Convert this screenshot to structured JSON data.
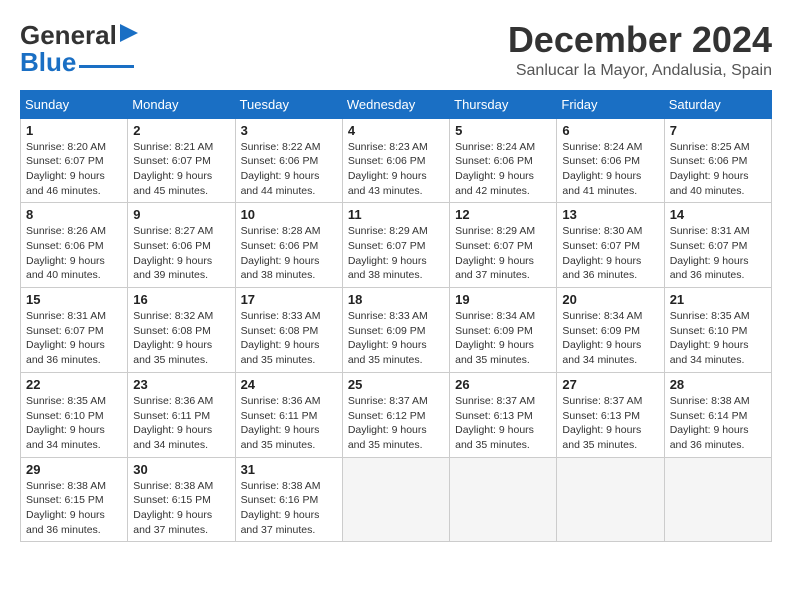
{
  "header": {
    "logo_line1": "General",
    "logo_line2": "Blue",
    "month_title": "December 2024",
    "location": "Sanlucar la Mayor, Andalusia, Spain"
  },
  "calendar": {
    "weekdays": [
      "Sunday",
      "Monday",
      "Tuesday",
      "Wednesday",
      "Thursday",
      "Friday",
      "Saturday"
    ],
    "weeks": [
      [
        {
          "day": "1",
          "sunrise": "Sunrise: 8:20 AM",
          "sunset": "Sunset: 6:07 PM",
          "daylight": "Daylight: 9 hours and 46 minutes."
        },
        {
          "day": "2",
          "sunrise": "Sunrise: 8:21 AM",
          "sunset": "Sunset: 6:07 PM",
          "daylight": "Daylight: 9 hours and 45 minutes."
        },
        {
          "day": "3",
          "sunrise": "Sunrise: 8:22 AM",
          "sunset": "Sunset: 6:06 PM",
          "daylight": "Daylight: 9 hours and 44 minutes."
        },
        {
          "day": "4",
          "sunrise": "Sunrise: 8:23 AM",
          "sunset": "Sunset: 6:06 PM",
          "daylight": "Daylight: 9 hours and 43 minutes."
        },
        {
          "day": "5",
          "sunrise": "Sunrise: 8:24 AM",
          "sunset": "Sunset: 6:06 PM",
          "daylight": "Daylight: 9 hours and 42 minutes."
        },
        {
          "day": "6",
          "sunrise": "Sunrise: 8:24 AM",
          "sunset": "Sunset: 6:06 PM",
          "daylight": "Daylight: 9 hours and 41 minutes."
        },
        {
          "day": "7",
          "sunrise": "Sunrise: 8:25 AM",
          "sunset": "Sunset: 6:06 PM",
          "daylight": "Daylight: 9 hours and 40 minutes."
        }
      ],
      [
        {
          "day": "8",
          "sunrise": "Sunrise: 8:26 AM",
          "sunset": "Sunset: 6:06 PM",
          "daylight": "Daylight: 9 hours and 40 minutes."
        },
        {
          "day": "9",
          "sunrise": "Sunrise: 8:27 AM",
          "sunset": "Sunset: 6:06 PM",
          "daylight": "Daylight: 9 hours and 39 minutes."
        },
        {
          "day": "10",
          "sunrise": "Sunrise: 8:28 AM",
          "sunset": "Sunset: 6:06 PM",
          "daylight": "Daylight: 9 hours and 38 minutes."
        },
        {
          "day": "11",
          "sunrise": "Sunrise: 8:29 AM",
          "sunset": "Sunset: 6:07 PM",
          "daylight": "Daylight: 9 hours and 38 minutes."
        },
        {
          "day": "12",
          "sunrise": "Sunrise: 8:29 AM",
          "sunset": "Sunset: 6:07 PM",
          "daylight": "Daylight: 9 hours and 37 minutes."
        },
        {
          "day": "13",
          "sunrise": "Sunrise: 8:30 AM",
          "sunset": "Sunset: 6:07 PM",
          "daylight": "Daylight: 9 hours and 36 minutes."
        },
        {
          "day": "14",
          "sunrise": "Sunrise: 8:31 AM",
          "sunset": "Sunset: 6:07 PM",
          "daylight": "Daylight: 9 hours and 36 minutes."
        }
      ],
      [
        {
          "day": "15",
          "sunrise": "Sunrise: 8:31 AM",
          "sunset": "Sunset: 6:07 PM",
          "daylight": "Daylight: 9 hours and 36 minutes."
        },
        {
          "day": "16",
          "sunrise": "Sunrise: 8:32 AM",
          "sunset": "Sunset: 6:08 PM",
          "daylight": "Daylight: 9 hours and 35 minutes."
        },
        {
          "day": "17",
          "sunrise": "Sunrise: 8:33 AM",
          "sunset": "Sunset: 6:08 PM",
          "daylight": "Daylight: 9 hours and 35 minutes."
        },
        {
          "day": "18",
          "sunrise": "Sunrise: 8:33 AM",
          "sunset": "Sunset: 6:09 PM",
          "daylight": "Daylight: 9 hours and 35 minutes."
        },
        {
          "day": "19",
          "sunrise": "Sunrise: 8:34 AM",
          "sunset": "Sunset: 6:09 PM",
          "daylight": "Daylight: 9 hours and 35 minutes."
        },
        {
          "day": "20",
          "sunrise": "Sunrise: 8:34 AM",
          "sunset": "Sunset: 6:09 PM",
          "daylight": "Daylight: 9 hours and 34 minutes."
        },
        {
          "day": "21",
          "sunrise": "Sunrise: 8:35 AM",
          "sunset": "Sunset: 6:10 PM",
          "daylight": "Daylight: 9 hours and 34 minutes."
        }
      ],
      [
        {
          "day": "22",
          "sunrise": "Sunrise: 8:35 AM",
          "sunset": "Sunset: 6:10 PM",
          "daylight": "Daylight: 9 hours and 34 minutes."
        },
        {
          "day": "23",
          "sunrise": "Sunrise: 8:36 AM",
          "sunset": "Sunset: 6:11 PM",
          "daylight": "Daylight: 9 hours and 34 minutes."
        },
        {
          "day": "24",
          "sunrise": "Sunrise: 8:36 AM",
          "sunset": "Sunset: 6:11 PM",
          "daylight": "Daylight: 9 hours and 35 minutes."
        },
        {
          "day": "25",
          "sunrise": "Sunrise: 8:37 AM",
          "sunset": "Sunset: 6:12 PM",
          "daylight": "Daylight: 9 hours and 35 minutes."
        },
        {
          "day": "26",
          "sunrise": "Sunrise: 8:37 AM",
          "sunset": "Sunset: 6:13 PM",
          "daylight": "Daylight: 9 hours and 35 minutes."
        },
        {
          "day": "27",
          "sunrise": "Sunrise: 8:37 AM",
          "sunset": "Sunset: 6:13 PM",
          "daylight": "Daylight: 9 hours and 35 minutes."
        },
        {
          "day": "28",
          "sunrise": "Sunrise: 8:38 AM",
          "sunset": "Sunset: 6:14 PM",
          "daylight": "Daylight: 9 hours and 36 minutes."
        }
      ],
      [
        {
          "day": "29",
          "sunrise": "Sunrise: 8:38 AM",
          "sunset": "Sunset: 6:15 PM",
          "daylight": "Daylight: 9 hours and 36 minutes."
        },
        {
          "day": "30",
          "sunrise": "Sunrise: 8:38 AM",
          "sunset": "Sunset: 6:15 PM",
          "daylight": "Daylight: 9 hours and 37 minutes."
        },
        {
          "day": "31",
          "sunrise": "Sunrise: 8:38 AM",
          "sunset": "Sunset: 6:16 PM",
          "daylight": "Daylight: 9 hours and 37 minutes."
        },
        null,
        null,
        null,
        null
      ]
    ]
  }
}
